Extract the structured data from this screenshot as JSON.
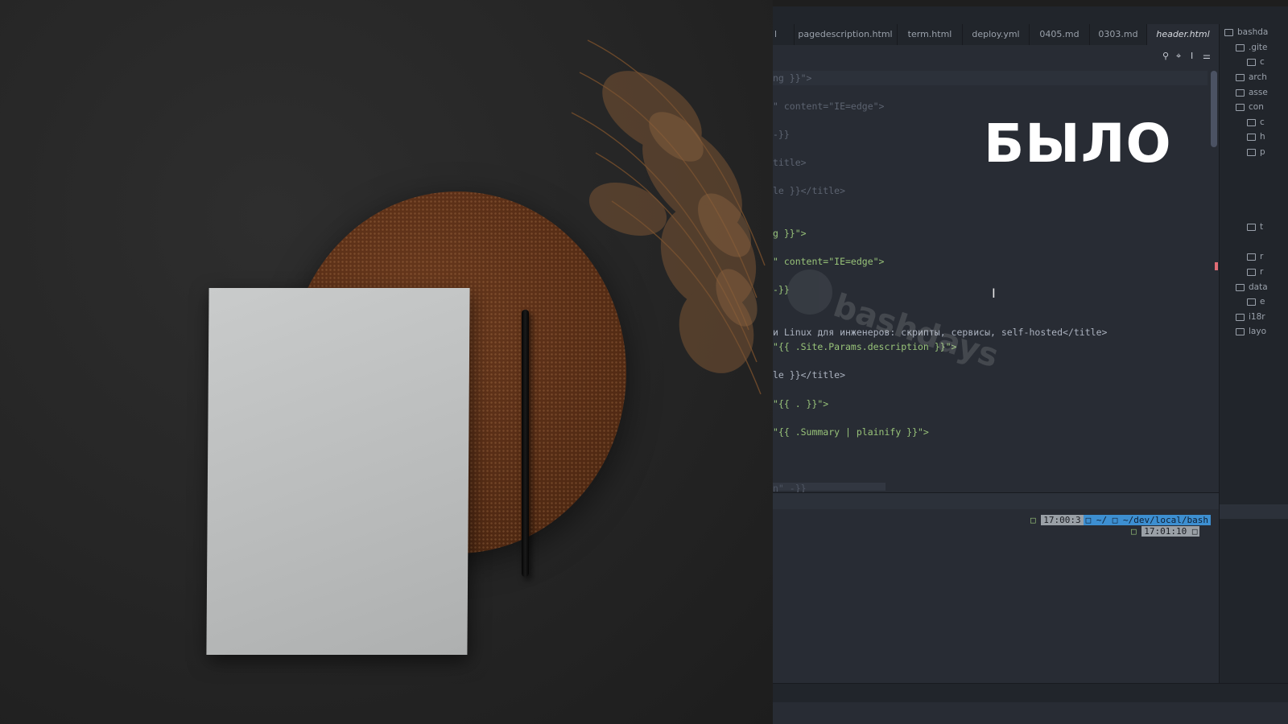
{
  "ide": {
    "tabs": [
      {
        "label": "l",
        "left": 0
      },
      {
        "label": "pagedescription.html"
      },
      {
        "label": "term.html"
      },
      {
        "label": "deploy.yml"
      },
      {
        "label": "0405.md"
      },
      {
        "label": "0303.md"
      },
      {
        "label": "header.html",
        "active": true
      }
    ],
    "toolbar_icons": [
      "search-icon",
      "find-replace-icon",
      "text-cursor-icon",
      "settings-sliders-icon"
    ],
    "code_lines": [
      {
        "text": "ng }}\">"
      },
      {
        "text": "\" content=\"IE=edge\">"
      },
      {
        "text": "-}}"
      },
      {
        "text": "title>"
      },
      {
        "text": "le }}</title>"
      },
      {
        "text": "g }}\">"
      },
      {
        "text": "\" content=\"IE=edge\">"
      },
      {
        "text": "-}}"
      },
      {
        "text": "и Linux для инженеров: скрипты, сервисы, self-hosted</title>"
      },
      {
        "text": "\"{{ .Site.Params.description }}\">"
      },
      {
        "text": "le }}</title>"
      },
      {
        "text": "\"{{ . }}\">"
      },
      {
        "text": "\"{{ .Summary | plainify }}\">"
      },
      {
        "text": "n\" -}}"
      }
    ],
    "overlay_word": "БЫЛО",
    "watermark_text": "bashdays",
    "terminal": {
      "line1_time": "17:00:3",
      "line1_home": "~/",
      "line1_path": "~/dev/local/bash",
      "line2_time": "17:01:10"
    },
    "tree": [
      "bashda",
      ".gite",
      "c",
      "arch",
      "asse",
      "con",
      "c",
      "h",
      "p",
      "t",
      "r",
      "r",
      "data",
      "e",
      "i18r",
      "layo"
    ]
  }
}
